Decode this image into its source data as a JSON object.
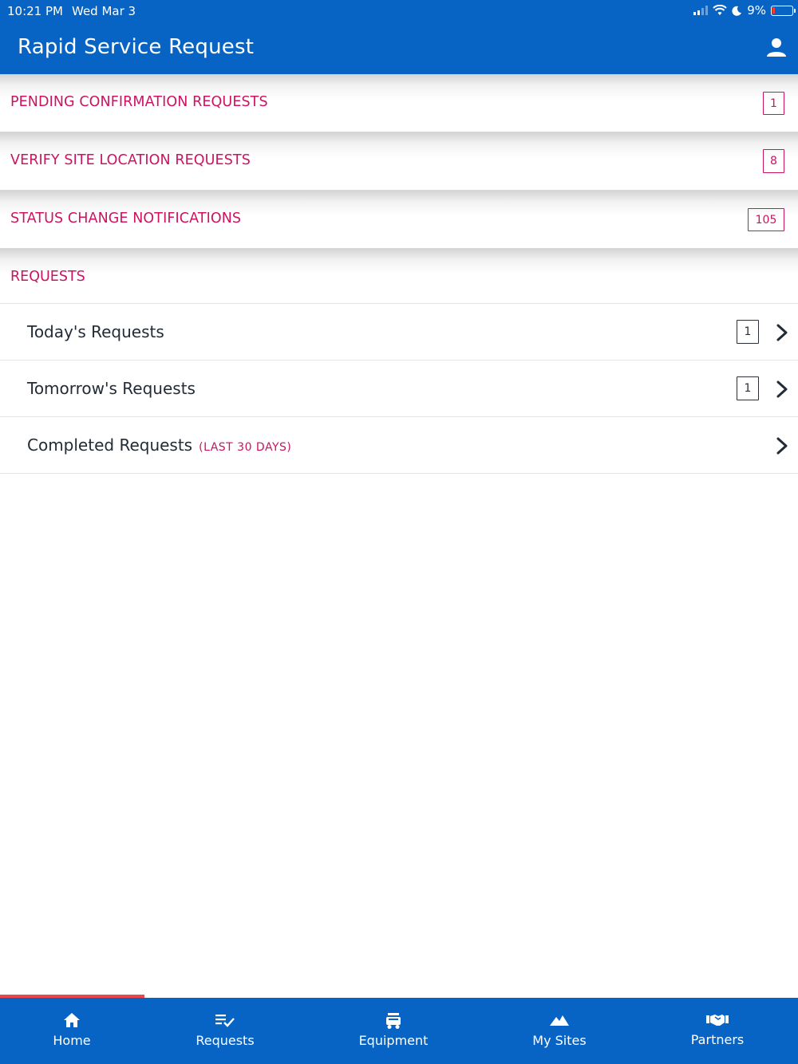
{
  "status_bar": {
    "time": "10:21 PM",
    "date": "Wed Mar 3",
    "battery_percent": "9%"
  },
  "header": {
    "title": "Rapid Service Request",
    "profile_icon": "person-icon"
  },
  "notifications": [
    {
      "label": "PENDING CONFIRMATION REQUESTS",
      "count": "1"
    },
    {
      "label": "VERIFY SITE LOCATION REQUESTS",
      "count": "8"
    },
    {
      "label": "STATUS CHANGE NOTIFICATIONS",
      "count": "105"
    }
  ],
  "requests_section": {
    "title": "REQUESTS",
    "items": [
      {
        "label": "Today's Requests",
        "count": "1"
      },
      {
        "label": "Tomorrow's Requests",
        "count": "1"
      },
      {
        "label": "Completed Requests",
        "sublabel": "(LAST 30 DAYS)"
      }
    ]
  },
  "tabs": [
    {
      "label": "Home",
      "icon": "home-icon",
      "active": true
    },
    {
      "label": "Requests",
      "icon": "list-check-icon"
    },
    {
      "label": "Equipment",
      "icon": "equipment-icon"
    },
    {
      "label": "My Sites",
      "icon": "mountain-icon"
    },
    {
      "label": "Partners",
      "icon": "handshake-icon"
    }
  ],
  "colors": {
    "brand_blue": "#0764c4",
    "accent_pink": "#cc1261",
    "active_tab_indicator": "#e8474c"
  }
}
